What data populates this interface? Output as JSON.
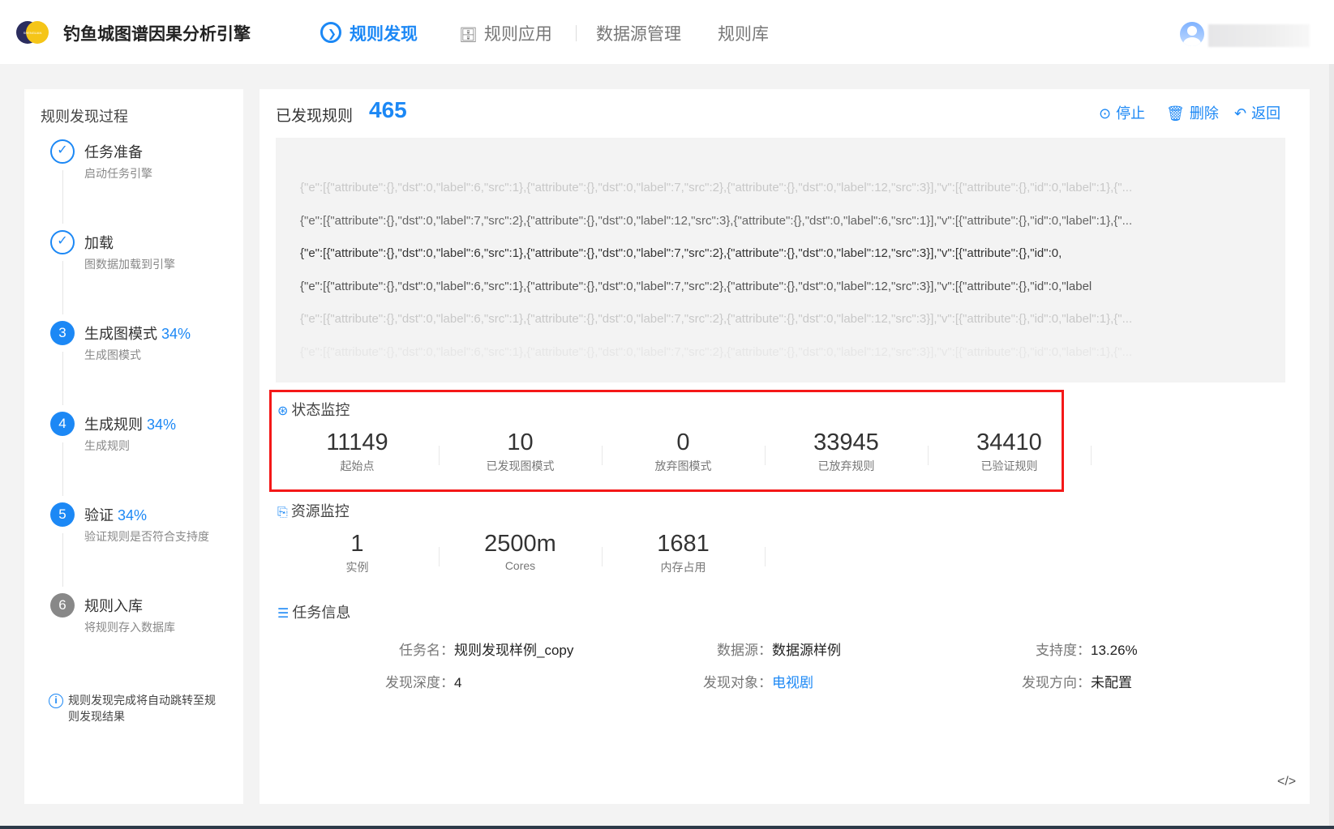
{
  "header": {
    "logo_text": "SHENGUAN",
    "app_title": "钓鱼城图谱因果分析引擎",
    "nav": [
      {
        "label": "规则发现",
        "active": true
      },
      {
        "label": "规则应用"
      },
      {
        "label": "数据源管理"
      },
      {
        "label": "规则库"
      }
    ]
  },
  "sidebar": {
    "title": "规则发现过程",
    "steps": [
      {
        "num": "1",
        "title": "任务准备",
        "pct": "",
        "desc": "启动任务引擎",
        "state": "done"
      },
      {
        "num": "2",
        "title": "加载",
        "pct": "",
        "desc": "图数据加载到引擎",
        "state": "done"
      },
      {
        "num": "3",
        "title": "生成图模式",
        "pct": "34%",
        "desc": "生成图模式",
        "state": "doing"
      },
      {
        "num": "4",
        "title": "生成规则",
        "pct": "34%",
        "desc": "生成规则",
        "state": "doing"
      },
      {
        "num": "5",
        "title": "验证",
        "pct": "34%",
        "desc": "验证规则是否符合支持度",
        "state": "doing"
      },
      {
        "num": "6",
        "title": "规则入库",
        "pct": "",
        "desc": "将规则存入数据库",
        "state": "wait"
      }
    ],
    "tip": "规则发现完成将自动跳转至规则发现结果"
  },
  "main": {
    "found_label": "已发现规则",
    "found_count": "465",
    "actions": {
      "stop": "停止",
      "delete": "删除",
      "back": "返回"
    },
    "json_lines": [
      "{\"e\":[{\"attribute\":{},\"dst\":0,\"label\":6,\"src\":1},{\"attribute\":{},\"dst\":0,\"label\":7,\"src\":2},{\"attribute\":{},\"dst\":0,\"label\":12,\"src\":3}],\"v\":[{\"attribute\":{},\"id\":0,\"label\":1},{\"...",
      "{\"e\":[{\"attribute\":{},\"dst\":0,\"label\":7,\"src\":2},{\"attribute\":{},\"dst\":0,\"label\":12,\"src\":3},{\"attribute\":{},\"dst\":0,\"label\":6,\"src\":1}],\"v\":[{\"attribute\":{},\"id\":0,\"label\":1},{\"...",
      "{\"e\":[{\"attribute\":{},\"dst\":0,\"label\":6,\"src\":1},{\"attribute\":{},\"dst\":0,\"label\":7,\"src\":2},{\"attribute\":{},\"dst\":0,\"label\":12,\"src\":3}],\"v\":[{\"attribute\":{},\"id\":0,",
      "{\"e\":[{\"attribute\":{},\"dst\":0,\"label\":6,\"src\":1},{\"attribute\":{},\"dst\":0,\"label\":7,\"src\":2},{\"attribute\":{},\"dst\":0,\"label\":12,\"src\":3}],\"v\":[{\"attribute\":{},\"id\":0,\"label",
      "{\"e\":[{\"attribute\":{},\"dst\":0,\"label\":6,\"src\":1},{\"attribute\":{},\"dst\":0,\"label\":7,\"src\":2},{\"attribute\":{},\"dst\":0,\"label\":12,\"src\":3}],\"v\":[{\"attribute\":{},\"id\":0,\"label\":1},{\"...",
      "{\"e\":[{\"attribute\":{},\"dst\":0,\"label\":6,\"src\":1},{\"attribute\":{},\"dst\":0,\"label\":7,\"src\":2},{\"attribute\":{},\"dst\":0,\"label\":12,\"src\":3}],\"v\":[{\"attribute\":{},\"id\":0,\"label\":1},{\"..."
    ],
    "status": {
      "title": "状态监控",
      "stats": [
        {
          "value": "11149",
          "label": "起始点"
        },
        {
          "value": "10",
          "label": "已发现图模式"
        },
        {
          "value": "0",
          "label": "放弃图模式"
        },
        {
          "value": "33945",
          "label": "已放弃规则"
        },
        {
          "value": "34410",
          "label": "已验证规则"
        }
      ]
    },
    "resource": {
      "title": "资源监控",
      "stats": [
        {
          "value": "1",
          "label": "实例"
        },
        {
          "value": "2500m",
          "label": "Cores"
        },
        {
          "value": "1681",
          "label": "内存占用"
        }
      ]
    },
    "task": {
      "title": "任务信息",
      "fields": [
        {
          "key": "任务名：",
          "value": "规则发现样例_copy"
        },
        {
          "key": "数据源：",
          "value": "数据源样例"
        },
        {
          "key": "支持度：",
          "value": "13.26%"
        },
        {
          "key": "发现深度：",
          "value": "4"
        },
        {
          "key": "发现对象：",
          "value": "电视剧",
          "link": true
        },
        {
          "key": "发现方向：",
          "value": "未配置"
        }
      ]
    },
    "code_toggle": "</>"
  },
  "colors": {
    "accent": "#1c88f5",
    "highlight_border": "#f41818"
  }
}
